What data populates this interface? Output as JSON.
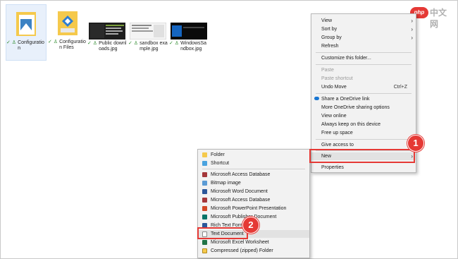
{
  "files": [
    {
      "name": "Configuration",
      "status": "✓ ♙"
    },
    {
      "name": "Configuration Files",
      "status": "✓ ♙"
    },
    {
      "name": "Public downloads.jpg",
      "status": "✓ ♙"
    },
    {
      "name": "sandbox example.jpg",
      "status": "✓ ♙"
    },
    {
      "name": "WindowsSandbox.jpg",
      "status": "✓ ♙"
    }
  ],
  "context_menu": {
    "items": [
      {
        "label": "View"
      },
      {
        "label": "Sort by"
      },
      {
        "label": "Group by"
      },
      {
        "label": "Refresh"
      },
      {
        "label": "Customize this folder..."
      },
      {
        "label": "Paste"
      },
      {
        "label": "Paste shortcut"
      },
      {
        "label": "Undo Move",
        "shortcut": "Ctrl+Z"
      },
      {
        "label": "Share a OneDrive link"
      },
      {
        "label": "More OneDrive sharing options"
      },
      {
        "label": "View online"
      },
      {
        "label": "Always keep on this device"
      },
      {
        "label": "Free up space"
      },
      {
        "label": "Give access to"
      },
      {
        "label": "New"
      },
      {
        "label": "Properties"
      }
    ]
  },
  "new_submenu": {
    "items": [
      {
        "label": "Folder",
        "icon": "folder-icon"
      },
      {
        "label": "Shortcut",
        "icon": "shortcut-icon"
      },
      {
        "label": "Microsoft Access Database",
        "icon": "access-icon"
      },
      {
        "label": "Bitmap image",
        "icon": "bitmap-icon"
      },
      {
        "label": "Microsoft Word Document",
        "icon": "word-icon"
      },
      {
        "label": "Microsoft Access Database",
        "icon": "access-icon"
      },
      {
        "label": "Microsoft PowerPoint Presentation",
        "icon": "powerpoint-icon"
      },
      {
        "label": "Microsoft Publisher Document",
        "icon": "publisher-icon"
      },
      {
        "label": "Rich Text Format",
        "icon": "rtf-icon"
      },
      {
        "label": "Text Document",
        "icon": "text-icon"
      },
      {
        "label": "Microsoft Excel Worksheet",
        "icon": "excel-icon"
      },
      {
        "label": "Compressed (zipped) Folder",
        "icon": "zip-icon"
      }
    ]
  },
  "callouts": {
    "one": "1",
    "two": "2"
  },
  "watermark": {
    "pill": "php",
    "text": "中文网"
  },
  "colors": {
    "accent": "#e53935",
    "menu_bg": "#f2f2f2",
    "onedrive": "#1976d2"
  }
}
